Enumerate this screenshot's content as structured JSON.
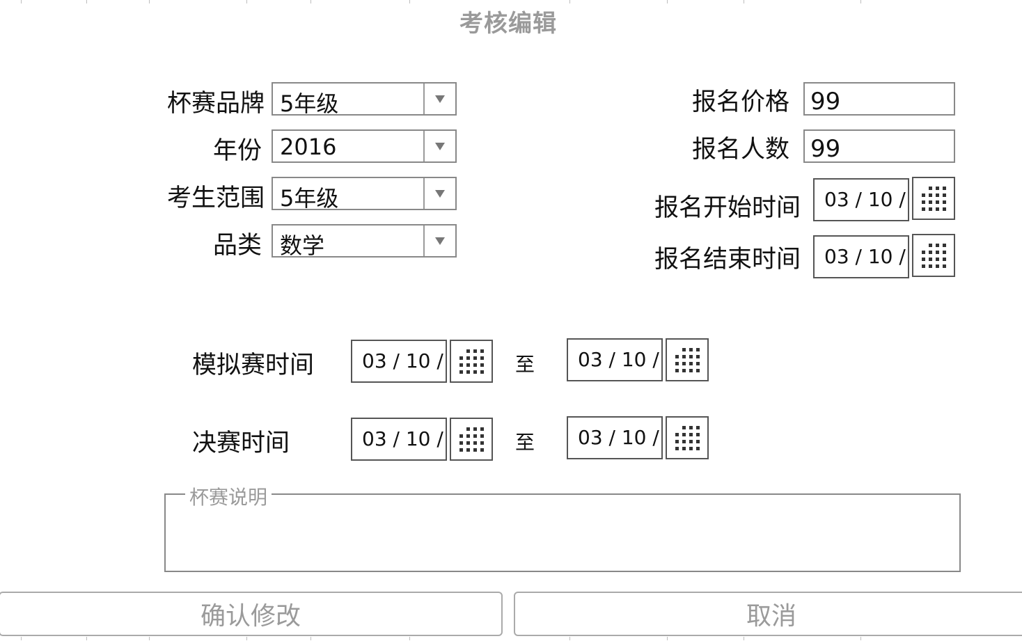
{
  "dialog": {
    "title": "考核编辑"
  },
  "left_form": {
    "brand": {
      "label": "杯赛品牌",
      "value": "5年级"
    },
    "year": {
      "label": "年份",
      "value": "2016"
    },
    "range": {
      "label": "考生范围",
      "value": "5年级"
    },
    "category": {
      "label": "品类",
      "value": "数学"
    }
  },
  "right_form": {
    "price": {
      "label": "报名价格",
      "value": "99"
    },
    "count": {
      "label": "报名人数",
      "value": "99"
    },
    "reg_start": {
      "label": "报名开始时间",
      "value": "03 / 10 /"
    },
    "reg_end": {
      "label": "报名结束时间",
      "value": "03 / 10 /"
    }
  },
  "mock_time": {
    "label": "模拟赛时间",
    "start": "03 / 10 /",
    "to": "至",
    "end": "03 / 10 /"
  },
  "final_time": {
    "label": "决赛时间",
    "start": "03 / 10 /",
    "to": "至",
    "end": "03 / 10 /"
  },
  "description": {
    "legend": "杯赛说明",
    "value": ""
  },
  "buttons": {
    "confirm": "确认修改",
    "cancel": "取消"
  },
  "icons": {
    "dropdown": "triangle-down-icon",
    "calendar": "calendar-grid-icon"
  },
  "colors": {
    "disabled_text": "#9a9a9a",
    "border": "#888888"
  }
}
